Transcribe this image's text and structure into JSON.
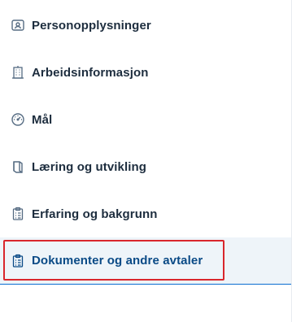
{
  "nav": {
    "items": [
      {
        "label": "Personopplysninger",
        "icon": "person-card-icon",
        "active": false
      },
      {
        "label": "Arbeidsinformasjon",
        "icon": "building-icon",
        "active": false
      },
      {
        "label": "Mål",
        "icon": "target-gauge-icon",
        "active": false
      },
      {
        "label": "Læring og utvikling",
        "icon": "book-icon",
        "active": false
      },
      {
        "label": "Erfaring og bakgrunn",
        "icon": "clipboard-list-icon",
        "active": false
      },
      {
        "label": "Dokumenter og andre avtaler",
        "icon": "clipboard-document-icon",
        "active": true
      }
    ]
  },
  "colors": {
    "text": "#1d2d3e",
    "icon": "#556b82",
    "active_text": "#0a4a86",
    "active_background": "#eef4f9",
    "active_underline": "#0a6ed1",
    "highlight_border": "#d9262c"
  }
}
